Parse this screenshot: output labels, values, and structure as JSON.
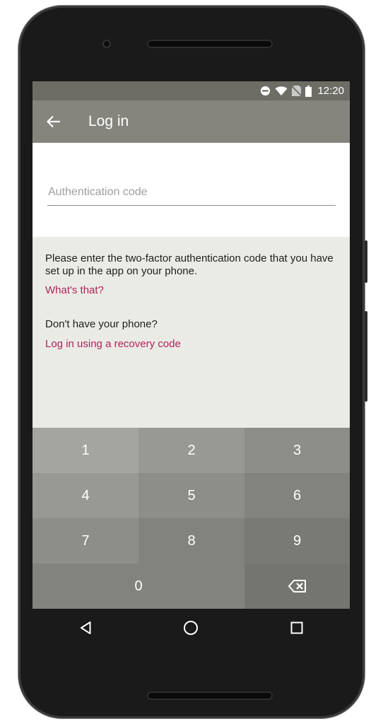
{
  "status_bar": {
    "time": "12:20",
    "icons": [
      "do-not-disturb-icon",
      "wifi-icon",
      "no-sim-icon",
      "battery-icon"
    ]
  },
  "app_bar": {
    "back_icon": "arrow-left-icon",
    "title": "Log in"
  },
  "form": {
    "code_input": {
      "value": "",
      "placeholder": "Authentication code"
    }
  },
  "help": {
    "instructions": "Please enter the two-factor authentication code that you have set up in the app on your phone.",
    "whats_that_link": "What's that?",
    "no_phone_text": "Don't have your phone?",
    "recovery_link": "Log in using a recovery code"
  },
  "keypad": {
    "keys": [
      "1",
      "2",
      "3",
      "4",
      "5",
      "6",
      "7",
      "8",
      "9",
      "0"
    ],
    "backspace_icon": "backspace-icon"
  },
  "nav_bar": {
    "icons": [
      "back-triangle-icon",
      "home-circle-icon",
      "recents-square-icon"
    ]
  },
  "colors": {
    "app_bar": "#85857d",
    "status_bar": "#6d6d66",
    "link": "#b0225b",
    "background": "#ebebe6"
  }
}
